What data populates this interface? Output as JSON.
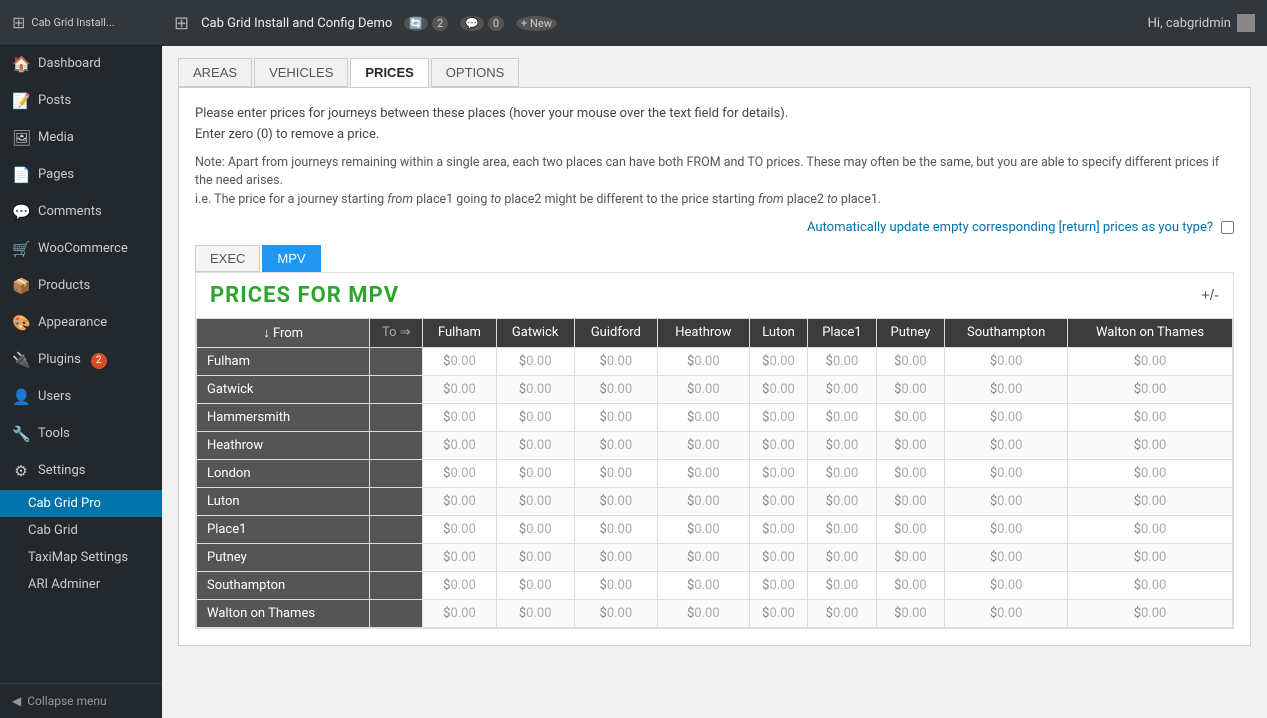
{
  "adminBar": {
    "wpLogo": "⊞",
    "siteTitle": "Cab Grid Install and Config Demo",
    "updates": "2",
    "comments": "0",
    "newLabel": "+ New",
    "hiText": "Hi, cabgridmin"
  },
  "sidebar": {
    "menuItems": [
      {
        "id": "dashboard",
        "icon": "🏠",
        "label": "Dashboard"
      },
      {
        "id": "posts",
        "icon": "📝",
        "label": "Posts"
      },
      {
        "id": "media",
        "icon": "🖼",
        "label": "Media"
      },
      {
        "id": "pages",
        "icon": "📄",
        "label": "Pages"
      },
      {
        "id": "comments",
        "icon": "💬",
        "label": "Comments"
      },
      {
        "id": "woocommerce",
        "icon": "🛒",
        "label": "WooCommerce"
      },
      {
        "id": "products",
        "icon": "📦",
        "label": "Products"
      },
      {
        "id": "appearance",
        "icon": "🎨",
        "label": "Appearance"
      },
      {
        "id": "plugins",
        "icon": "🔌",
        "label": "Plugins",
        "badge": "2"
      },
      {
        "id": "users",
        "icon": "👤",
        "label": "Users"
      },
      {
        "id": "tools",
        "icon": "🔧",
        "label": "Tools"
      },
      {
        "id": "settings",
        "icon": "⚙",
        "label": "Settings"
      }
    ],
    "subMenuItems": [
      {
        "id": "cab-grid-pro",
        "label": "Cab Grid Pro",
        "active": true
      },
      {
        "id": "cab-grid",
        "label": "Cab Grid"
      },
      {
        "id": "taximap-settings",
        "label": "TaxiMap Settings"
      },
      {
        "id": "ari-adminer",
        "label": "ARI Adminer"
      }
    ],
    "collapseLabel": "Collapse menu"
  },
  "tabs": [
    {
      "id": "areas",
      "label": "AREAS"
    },
    {
      "id": "vehicles",
      "label": "VEHICLES"
    },
    {
      "id": "prices",
      "label": "PRICES",
      "active": true
    },
    {
      "id": "options",
      "label": "OPTIONS"
    }
  ],
  "infoText1": "Please enter prices for journeys between these places (hover your mouse over the text field for details).",
  "infoText2": "Enter zero (0) to remove a price.",
  "noteText1": "Note: Apart from journeys remaining within a single area, each two places can have both FROM and TO prices. These may often be the same, but you are able to specify different prices if the need arises.",
  "noteText2": "i.e. The price for a journey starting from place1 going to place2 might be different to the price starting from place2 to place1.",
  "autoUpdateLabel": "Automatically update empty corresponding [return] prices as you type?",
  "vehicleTabs": [
    {
      "id": "exec",
      "label": "EXEC"
    },
    {
      "id": "mpv",
      "label": "MPV",
      "active": true
    }
  ],
  "priceSectionTitle": "PRICES FOR MPV",
  "plusMinus": "+/-",
  "tableHeaders": {
    "fromLabel": "↓ From",
    "toLabel": "To ⇒",
    "columns": [
      "Fulham",
      "Gatwick",
      "Guidford",
      "Heathrow",
      "Luton",
      "Place1",
      "Putney",
      "Southampton",
      "Walton on Thames"
    ]
  },
  "tableRows": [
    {
      "label": "Fulham",
      "values": [
        "$0.00",
        "$0.00",
        "$0.00",
        "$0.00",
        "$0.00",
        "$0.00",
        "$0.00",
        "$0.00",
        "$0.00"
      ]
    },
    {
      "label": "Gatwick",
      "values": [
        "$0.00",
        "$0.00",
        "$0.00",
        "$0.00",
        "$0.00",
        "$0.00",
        "$0.00",
        "$0.00",
        "$0.00"
      ]
    },
    {
      "label": "Hammersmith",
      "values": [
        "$0.00",
        "$0.00",
        "$0.00",
        "$0.00",
        "$0.00",
        "$0.00",
        "$0.00",
        "$0.00",
        "$0.00"
      ]
    },
    {
      "label": "Heathrow",
      "values": [
        "$0.00",
        "$0.00",
        "$0.00",
        "$0.00",
        "$0.00",
        "$0.00",
        "$0.00",
        "$0.00",
        "$0.00"
      ]
    },
    {
      "label": "London",
      "values": [
        "$0.00",
        "$0.00",
        "$0.00",
        "$0.00",
        "$0.00",
        "$0.00",
        "$0.00",
        "$0.00",
        "$0.00"
      ]
    },
    {
      "label": "Luton",
      "values": [
        "$0.00",
        "$0.00",
        "$0.00",
        "$0.00",
        "$0.00",
        "$0.00",
        "$0.00",
        "$0.00",
        "$0.00"
      ]
    },
    {
      "label": "Place1",
      "values": [
        "$0.00",
        "$0.00",
        "$0.00",
        "$0.00",
        "$0.00",
        "$0.00",
        "$0.00",
        "$0.00",
        "$0.00"
      ]
    },
    {
      "label": "Putney",
      "values": [
        "$0.00",
        "$0.00",
        "$0.00",
        "$0.00",
        "$0.00",
        "$0.00",
        "$0.00",
        "$0.00",
        "$0.00"
      ]
    },
    {
      "label": "Southampton",
      "values": [
        "$0.00",
        "$0.00",
        "$0.00",
        "$0.00",
        "$0.00",
        "$0.00",
        "$0.00",
        "$0.00",
        "$0.00"
      ]
    },
    {
      "label": "Walton on Thames",
      "values": [
        "$0.00",
        "$0.00",
        "$0.00",
        "$0.00",
        "$0.00",
        "$0.00",
        "$0.00",
        "$0.00",
        "$0.00"
      ]
    }
  ]
}
